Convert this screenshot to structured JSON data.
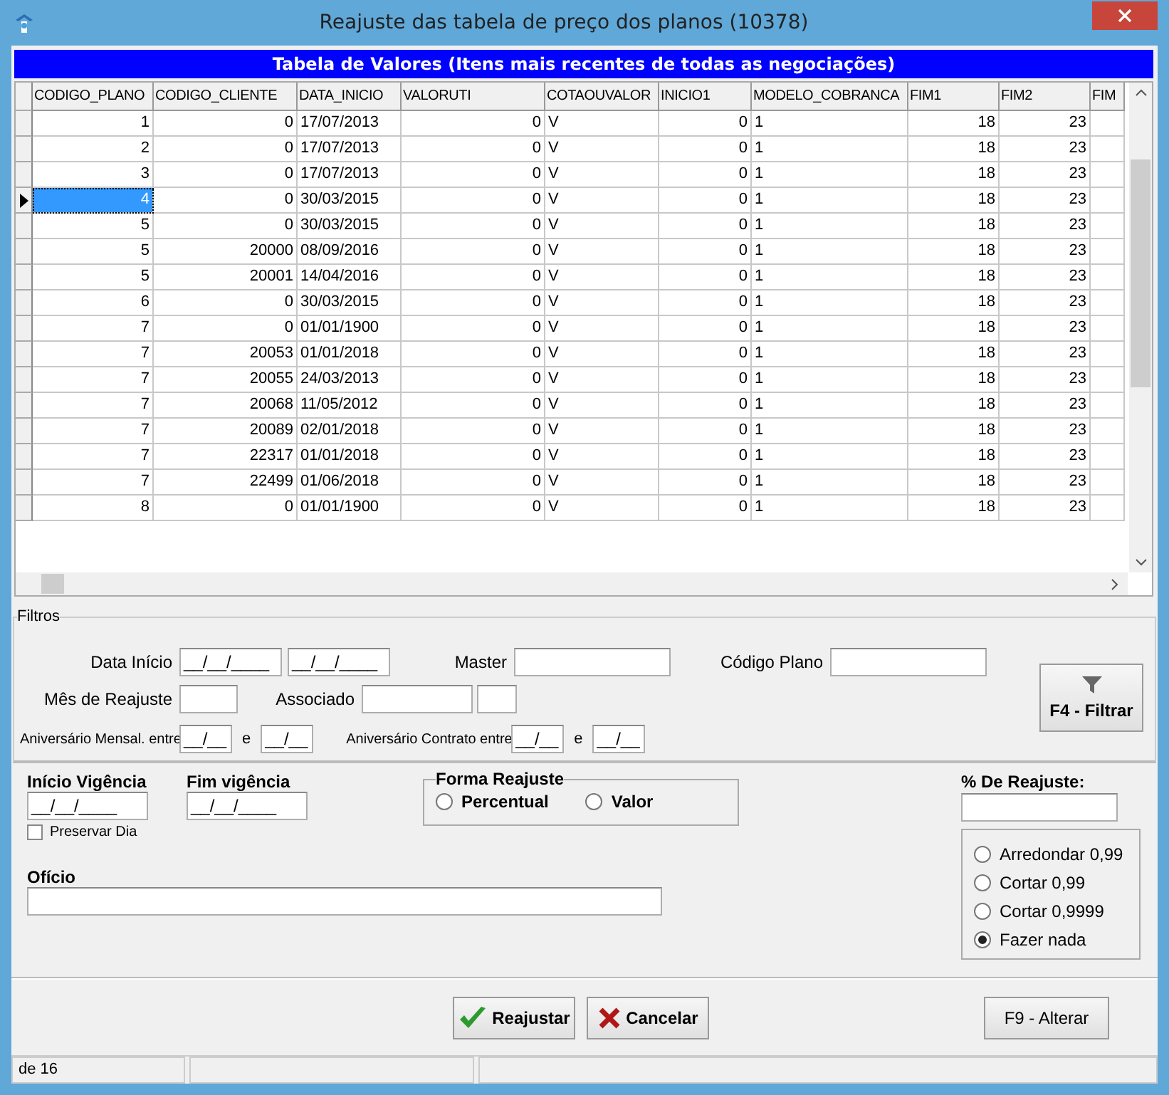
{
  "window": {
    "title": "Reajuste das tabela de preço dos planos (10378)"
  },
  "table": {
    "title": "Tabela de Valores (Itens mais recentes de todas as negociações)",
    "columns": [
      "CODIGO_PLANO",
      "CODIGO_CLIENTE",
      "DATA_INICIO",
      "VALORUTI",
      "COTAOUVALOR",
      "INICIO1",
      "MODELO_COBRANCA",
      "FIM1",
      "FIM2",
      "FIM"
    ],
    "rows": [
      {
        "selected": false,
        "cells": [
          "1",
          "0",
          "17/07/2013",
          "0",
          "V",
          "0",
          "1",
          "18",
          "23"
        ]
      },
      {
        "selected": false,
        "cells": [
          "2",
          "0",
          "17/07/2013",
          "0",
          "V",
          "0",
          "1",
          "18",
          "23"
        ]
      },
      {
        "selected": false,
        "cells": [
          "3",
          "0",
          "17/07/2013",
          "0",
          "V",
          "0",
          "1",
          "18",
          "23"
        ]
      },
      {
        "selected": true,
        "cells": [
          "4",
          "0",
          "30/03/2015",
          "0",
          "V",
          "0",
          "1",
          "18",
          "23"
        ]
      },
      {
        "selected": false,
        "cells": [
          "5",
          "0",
          "30/03/2015",
          "0",
          "V",
          "0",
          "1",
          "18",
          "23"
        ]
      },
      {
        "selected": false,
        "cells": [
          "5",
          "20000",
          "08/09/2016",
          "0",
          "V",
          "0",
          "1",
          "18",
          "23"
        ]
      },
      {
        "selected": false,
        "cells": [
          "5",
          "20001",
          "14/04/2016",
          "0",
          "V",
          "0",
          "1",
          "18",
          "23"
        ]
      },
      {
        "selected": false,
        "cells": [
          "6",
          "0",
          "30/03/2015",
          "0",
          "V",
          "0",
          "1",
          "18",
          "23"
        ]
      },
      {
        "selected": false,
        "cells": [
          "7",
          "0",
          "01/01/1900",
          "0",
          "V",
          "0",
          "1",
          "18",
          "23"
        ]
      },
      {
        "selected": false,
        "cells": [
          "7",
          "20053",
          "01/01/2018",
          "0",
          "V",
          "0",
          "1",
          "18",
          "23"
        ]
      },
      {
        "selected": false,
        "cells": [
          "7",
          "20055",
          "24/03/2013",
          "0",
          "V",
          "0",
          "1",
          "18",
          "23"
        ]
      },
      {
        "selected": false,
        "cells": [
          "7",
          "20068",
          "11/05/2012",
          "0",
          "V",
          "0",
          "1",
          "18",
          "23"
        ]
      },
      {
        "selected": false,
        "cells": [
          "7",
          "20089",
          "02/01/2018",
          "0",
          "V",
          "0",
          "1",
          "18",
          "23"
        ]
      },
      {
        "selected": false,
        "cells": [
          "7",
          "22317",
          "01/01/2018",
          "0",
          "V",
          "0",
          "1",
          "18",
          "23"
        ]
      },
      {
        "selected": false,
        "cells": [
          "7",
          "22499",
          "01/06/2018",
          "0",
          "V",
          "0",
          "1",
          "18",
          "23"
        ]
      },
      {
        "selected": false,
        "cells": [
          "8",
          "0",
          "01/01/1900",
          "0",
          "V",
          "0",
          "1",
          "18",
          "23"
        ]
      }
    ]
  },
  "filters": {
    "title": "Filtros",
    "data_inicio": {
      "label": "Data Início",
      "from": "__/__/____",
      "to": "__/__/____"
    },
    "mes_reajuste": {
      "label": "Mês de Reajuste"
    },
    "master": {
      "label": "Master"
    },
    "associado": {
      "label": "Associado"
    },
    "codigo_plano": {
      "label": "Código Plano"
    },
    "aniversario_mensal": {
      "label": "Aniversário Mensal. entre",
      "from": "__/__",
      "and": "e",
      "to": "__/__"
    },
    "aniversario_contrato": {
      "label": "Aniversário Contrato entre",
      "from": "__/__",
      "and": "e",
      "to": "__/__"
    },
    "filter_button": "F4 - Filtrar"
  },
  "adjustment": {
    "inicio_vigencia": {
      "label": "Início Vigência",
      "value": "__/__/____"
    },
    "preservar_dia": {
      "label": "Preservar Dia",
      "checked": false
    },
    "fim_vigencia": {
      "label": "Fim vigência",
      "value": "__/__/____"
    },
    "forma_reajuste": {
      "title": "Forma Reajuste",
      "options": [
        {
          "label": "Percentual",
          "selected": false
        },
        {
          "label": "Valor",
          "selected": false
        }
      ]
    },
    "oficio": {
      "label": "Ofício"
    },
    "percent": {
      "label": "% De Reajuste:"
    },
    "rounding": [
      {
        "label": "Arredondar 0,99",
        "selected": false
      },
      {
        "label": "Cortar 0,99",
        "selected": false
      },
      {
        "label": "Cortar 0,9999",
        "selected": false
      },
      {
        "label": "Fazer nada",
        "selected": true
      }
    ]
  },
  "buttons": [
    {
      "kind": "confirm",
      "label": "Reajustar"
    },
    {
      "kind": "cancel",
      "label": "Cancelar"
    },
    {
      "kind": "plain",
      "label": "F9 - Alterar"
    }
  ],
  "status_bar": [
    "de 16"
  ]
}
